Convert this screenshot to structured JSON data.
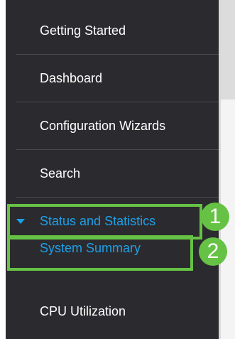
{
  "sidebar": {
    "items": [
      {
        "label": "Getting Started"
      },
      {
        "label": "Dashboard"
      },
      {
        "label": "Configuration Wizards"
      },
      {
        "label": "Search"
      },
      {
        "label": "Status and Statistics"
      },
      {
        "label": "System Summary"
      },
      {
        "label": "CPU Utilization"
      }
    ]
  },
  "annotations": {
    "badge1": "1",
    "badge2": "2"
  },
  "colors": {
    "sidebar_bg": "#2b2b2f",
    "active_text": "#1ea0e8",
    "highlight_green": "#66c244"
  },
  "icons": {
    "section_caret": "caret-down-icon"
  }
}
